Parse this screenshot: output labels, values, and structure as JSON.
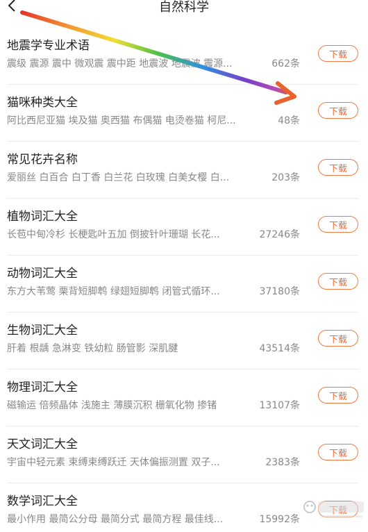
{
  "header": {
    "title": "自然科学",
    "back_icon": "chevron-left-icon"
  },
  "download_label": "下载",
  "items": [
    {
      "title": "地震学专业术语",
      "words": "震级 震源 震中 微观震 震中距 地震波 地震波 震源...",
      "count": "662条"
    },
    {
      "title": "猫咪种类大全",
      "words": "阿比西尼亚猫 埃及猫 奥西猫 布偶猫 电烫卷猫 柯尼...",
      "count": "48条"
    },
    {
      "title": "常见花卉名称",
      "words": "爱丽丝 白百合 白丁香 白兰花 白玫瑰 白美女樱 白...",
      "count": "203条"
    },
    {
      "title": "植物词汇大全",
      "words": "长苞中甸冷杉 长梗匙叶五加 倒披针叶珊瑚 长花...",
      "count": "27246条"
    },
    {
      "title": "动物词汇大全",
      "words": "东方大苇莺 栗背短脚鹎 绿翅短脚鹎 闭管式循环...",
      "count": "37180条"
    },
    {
      "title": "生物词汇大全",
      "words": "肝着 根龋 急淋变 铁幼粒 肠管影 深肌腱",
      "count": "43514条"
    },
    {
      "title": "物理词汇大全",
      "words": "磁输运 倍频晶体 浅施主 薄膜沉积 栅氧化物 掺锗",
      "count": "13107条"
    },
    {
      "title": "天文词汇大全",
      "words": "宇宙中轻元素 束缚束缚跃迁 天体偏振测置 双子...",
      "count": "2383条"
    },
    {
      "title": "数学词汇大全",
      "words": "最小作用 最简公分母 最简分式 最简方程 最佳线...",
      "count": "15992条"
    }
  ],
  "colors": {
    "accent": "#f06a2a",
    "text": "#222222",
    "secondary": "#888888"
  }
}
